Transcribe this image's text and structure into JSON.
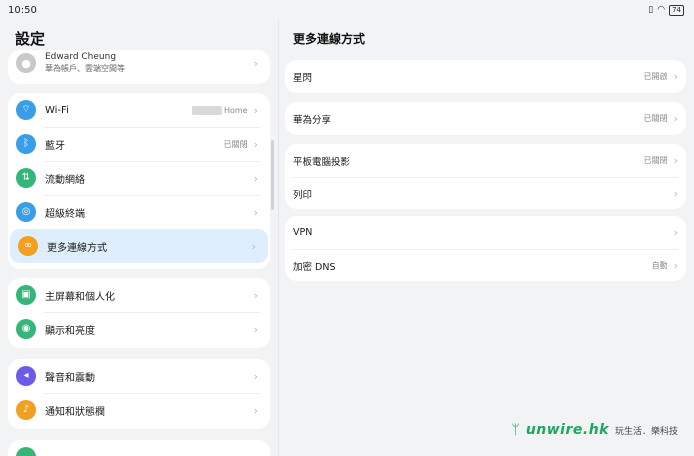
{
  "status_bar": {
    "time": "10:50",
    "battery": "74"
  },
  "left": {
    "title": "設定",
    "account": {
      "name": "Edward Cheung",
      "sub": "華為帳戶、雲端空間等"
    },
    "group1": [
      {
        "label": "Wi-Fi",
        "value": "Home",
        "icon": "wifi-icon",
        "color": "#3a9de8"
      },
      {
        "label": "藍牙",
        "value": "已關閉",
        "icon": "bluetooth-icon",
        "color": "#3a9de8"
      },
      {
        "label": "流動網絡",
        "value": "",
        "icon": "mobile-network-icon",
        "color": "#35b57a"
      },
      {
        "label": "超級終端",
        "value": "",
        "icon": "super-device-icon",
        "color": "#3a9de8"
      },
      {
        "label": "更多連線方式",
        "value": "",
        "icon": "link-icon",
        "color": "#f3a020"
      }
    ],
    "group2": [
      {
        "label": "主屏幕和個人化",
        "icon": "home-screen-icon",
        "color": "#35b57a"
      },
      {
        "label": "顯示和亮度",
        "icon": "display-icon",
        "color": "#35b57a"
      }
    ],
    "group3": [
      {
        "label": "聲音和震動",
        "icon": "sound-icon",
        "color": "#6b5be8"
      },
      {
        "label": "通知和狀態欄",
        "icon": "notification-icon",
        "color": "#f3a020"
      }
    ]
  },
  "right": {
    "title": "更多連線方式",
    "card1": [
      {
        "label": "星閃",
        "value": "已開啟"
      }
    ],
    "card2": [
      {
        "label": "華為分享",
        "value": "已關閉"
      }
    ],
    "card3": [
      {
        "label": "平板電腦投影",
        "value": "已關閉"
      },
      {
        "label": "列印",
        "value": ""
      }
    ],
    "card4": [
      {
        "label": "VPN",
        "value": ""
      },
      {
        "label": "加密 DNS",
        "value": "自動"
      }
    ]
  },
  "watermark": {
    "brand": "unwire.hk",
    "slogan": "玩生活．樂科技"
  },
  "colors": {
    "selected_bg": "#dfeefc",
    "background": "#f1f3f5",
    "brand_green": "#19a85d"
  }
}
